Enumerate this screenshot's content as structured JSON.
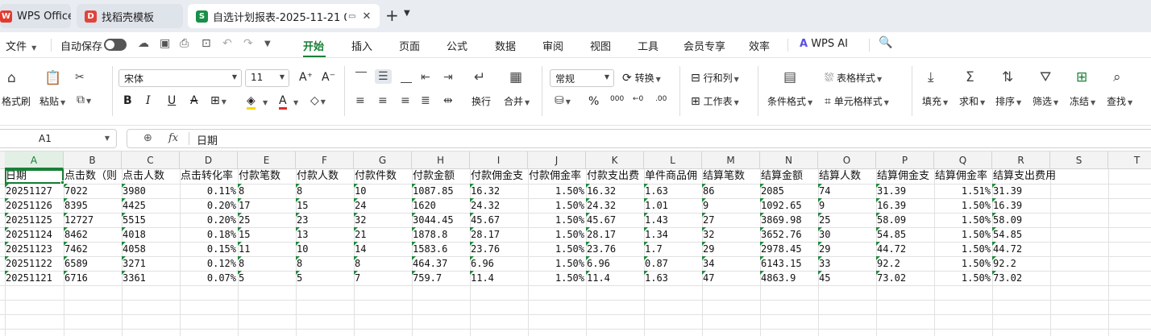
{
  "tabs": {
    "wps": {
      "label": "WPS Office"
    },
    "template": {
      "label": "找稻壳模板"
    },
    "doc": {
      "label": "自选计划报表-2025-11-21 0("
    }
  },
  "menubar": {
    "file": "文件",
    "autosave": "自动保存",
    "tabs": [
      "开始",
      "插入",
      "页面",
      "公式",
      "数据",
      "审阅",
      "视图",
      "工具",
      "会员专享",
      "效率"
    ],
    "wps_ai": "WPS AI"
  },
  "ribbon": {
    "format_painter": "格式刷",
    "paste": "粘贴",
    "font_name": "宋体",
    "font_size": "11",
    "wrap": "换行",
    "merge": "合并",
    "number_format": "常规",
    "convert": "转换",
    "row_col": "行和列",
    "worksheet": "工作表",
    "cond_format": "条件格式",
    "table_style": "表格样式",
    "cell_style": "单元格样式",
    "fill": "填充",
    "sum": "求和",
    "sort": "排序",
    "filter": "筛选",
    "freeze": "冻结",
    "find": "查找"
  },
  "formula": {
    "cell_ref": "A1",
    "value": "日期"
  },
  "grid": {
    "columns": [
      "A",
      "B",
      "C",
      "D",
      "E",
      "F",
      "G",
      "H",
      "I",
      "J",
      "K",
      "L",
      "M",
      "N",
      "O",
      "P",
      "Q",
      "R",
      "S",
      "T"
    ],
    "headers": [
      "日期",
      "点击数（则",
      "点击人数",
      "点击转化率",
      "付款笔数",
      "付款人数",
      "付款件数",
      "付款金额",
      "付款佣金支",
      "付款佣金率",
      "付款支出费",
      "单件商品佣",
      "结算笔数",
      "结算金额",
      "结算人数",
      "结算佣金支",
      "结算佣金率",
      "结算支出费用"
    ],
    "rows": [
      [
        "20251127",
        "7022",
        "3980",
        "0.11%",
        "8",
        "8",
        "10",
        "1087.85",
        "16.32",
        "1.50%",
        "16.32",
        "1.63",
        "86",
        "2085",
        "74",
        "31.39",
        "1.51%",
        "31.39"
      ],
      [
        "20251126",
        "8395",
        "4425",
        "0.20%",
        "17",
        "15",
        "24",
        "1620",
        "24.32",
        "1.50%",
        "24.32",
        "1.01",
        "9",
        "1092.65",
        "9",
        "16.39",
        "1.50%",
        "16.39"
      ],
      [
        "20251125",
        "12727",
        "5515",
        "0.20%",
        "25",
        "23",
        "32",
        "3044.45",
        "45.67",
        "1.50%",
        "45.67",
        "1.43",
        "27",
        "3869.98",
        "25",
        "58.09",
        "1.50%",
        "58.09"
      ],
      [
        "20251124",
        "8462",
        "4018",
        "0.18%",
        "15",
        "13",
        "21",
        "1878.8",
        "28.17",
        "1.50%",
        "28.17",
        "1.34",
        "32",
        "3652.76",
        "30",
        "54.85",
        "1.50%",
        "54.85"
      ],
      [
        "20251123",
        "7462",
        "4058",
        "0.15%",
        "11",
        "10",
        "14",
        "1583.6",
        "23.76",
        "1.50%",
        "23.76",
        "1.7",
        "29",
        "2978.45",
        "29",
        "44.72",
        "1.50%",
        "44.72"
      ],
      [
        "20251122",
        "6589",
        "3271",
        "0.12%",
        "8",
        "8",
        "8",
        "464.37",
        "6.96",
        "1.50%",
        "6.96",
        "0.87",
        "34",
        "6143.15",
        "33",
        "92.2",
        "1.50%",
        "92.2"
      ],
      [
        "20251121",
        "6716",
        "3361",
        "0.07%",
        "5",
        "5",
        "7",
        "759.7",
        "11.4",
        "1.50%",
        "11.4",
        "1.63",
        "47",
        "4863.9",
        "45",
        "73.02",
        "1.50%",
        "73.02"
      ]
    ]
  },
  "colors": {
    "accent": "#1a7f37",
    "tri_marker": "#1e8a3c"
  }
}
